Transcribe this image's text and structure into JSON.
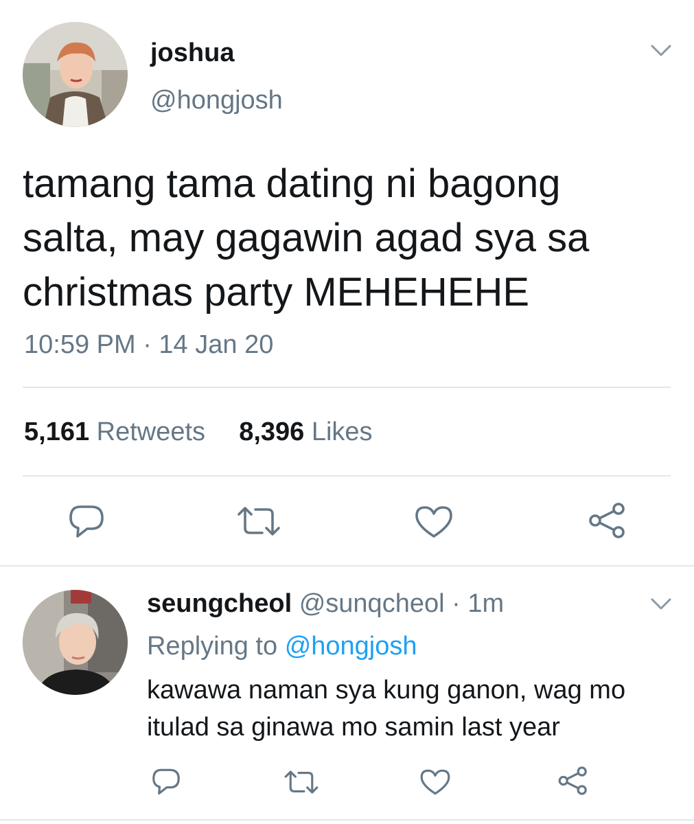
{
  "tweet": {
    "author": {
      "name": "joshua",
      "handle": "@hongjosh",
      "avatar_icon": "profile-photo"
    },
    "text_lines": [
      "tamang tama dating ni bagong",
      "salta, may gagawin agad sya sa",
      "christmas party MEHEHEHE"
    ],
    "timestamp": "10:59 PM · 14 Jan 20",
    "stats": {
      "retweets_count": "5,161",
      "retweets_label": "Retweets",
      "likes_count": "8,396",
      "likes_label": "Likes"
    },
    "actions": [
      "reply-icon",
      "retweet-icon",
      "like-icon",
      "share-icon"
    ]
  },
  "reply": {
    "author": {
      "name": "seungcheol",
      "handle": "@sunqcheol",
      "time": "· 1m",
      "avatar_icon": "profile-photo"
    },
    "replying_prefix": "Replying to",
    "replying_to": "@hongjosh",
    "text_lines": [
      "kawawa naman sya kung ganon, wag mo",
      "itulad sa ginawa mo samin last year"
    ],
    "actions": [
      "reply-icon",
      "retweet-icon",
      "like-icon",
      "share-icon"
    ]
  },
  "colors": {
    "text_primary": "#14171a",
    "text_secondary": "#657786",
    "link": "#1da1f2",
    "divider": "#e1e8ed",
    "icon": "#657786"
  }
}
